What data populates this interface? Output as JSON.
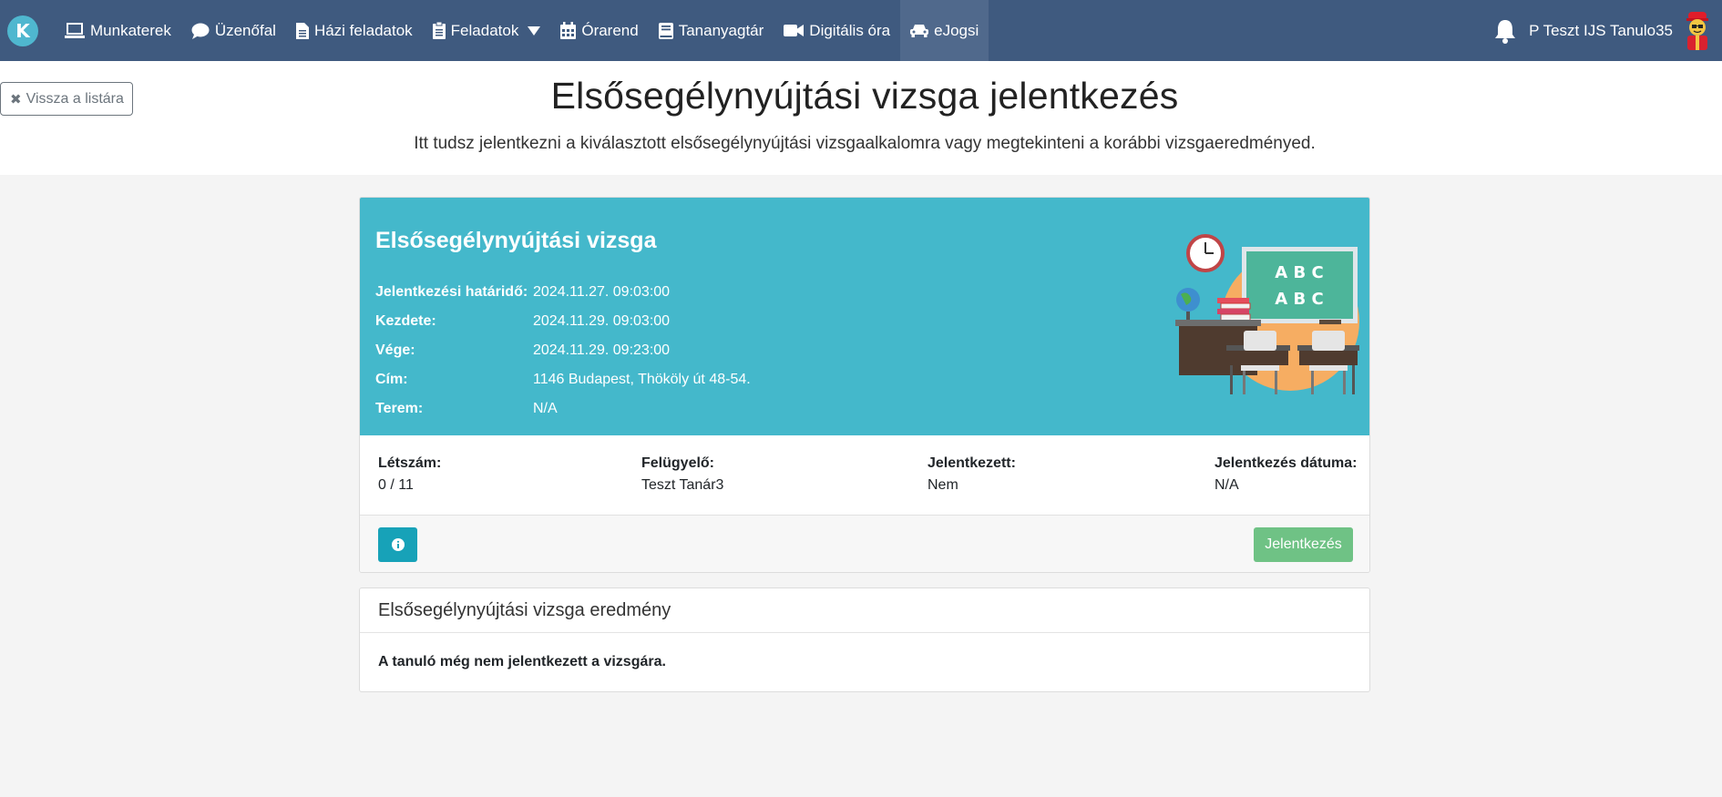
{
  "nav": {
    "brand_letter": "K",
    "items": [
      {
        "label": "Munkaterek",
        "icon": "laptop-icon"
      },
      {
        "label": "Üzenőfal",
        "icon": "chat-bubble-icon"
      },
      {
        "label": "Házi feladatok",
        "icon": "document-icon"
      },
      {
        "label": "Feladatok",
        "icon": "clipboard-icon"
      },
      {
        "label": "Órarend",
        "icon": "calendar-icon"
      },
      {
        "label": "Tananyagtár",
        "icon": "book-icon"
      },
      {
        "label": "Digitális óra",
        "icon": "video-camera-icon"
      },
      {
        "label": "eJogsi",
        "icon": "car-icon"
      }
    ],
    "username": "P Teszt IJS Tanulo35"
  },
  "header": {
    "back_label": "Vissza a listára",
    "title": "Elsősegélynyújtási vizsga jelentkezés",
    "subtitle": "Itt tudsz jelentkezni a kiválasztott elsősegélynyújtási vizsgaalkalomra vagy megtekinteni a korábbi vizsgaeredményed."
  },
  "exam": {
    "title": "Elsősegélynyújtási vizsga",
    "fields": [
      {
        "label": "Jelentkezési határidő:",
        "value": "2024.11.27. 09:03:00"
      },
      {
        "label": "Kezdete:",
        "value": "2024.11.29. 09:03:00"
      },
      {
        "label": "Vége:",
        "value": "2024.11.29. 09:23:00"
      },
      {
        "label": "Cím:",
        "value": "1146 Budapest, Thököly út 48-54."
      },
      {
        "label": "Terem:",
        "value": "N/A"
      }
    ],
    "chalkboard": [
      "A B C",
      "A B C"
    ],
    "stats": [
      {
        "label": "Létszám:",
        "value": "0 / 11"
      },
      {
        "label": "Felügyelő:",
        "value": "Teszt Tanár3"
      },
      {
        "label": "Jelentkezett:",
        "value": "Nem"
      },
      {
        "label": "Jelentkezés dátuma:",
        "value": "N/A"
      }
    ],
    "apply_label": "Jelentkezés"
  },
  "result": {
    "title": "Elsősegélynyújtási vizsga eredmény",
    "message": "A tanuló még nem jelentkezett a vizsgára."
  },
  "colors": {
    "navbar": "#3f5a7f",
    "card_accent": "#44b8cb",
    "info_button": "#17a2b8",
    "apply_button": "#6fc285"
  }
}
